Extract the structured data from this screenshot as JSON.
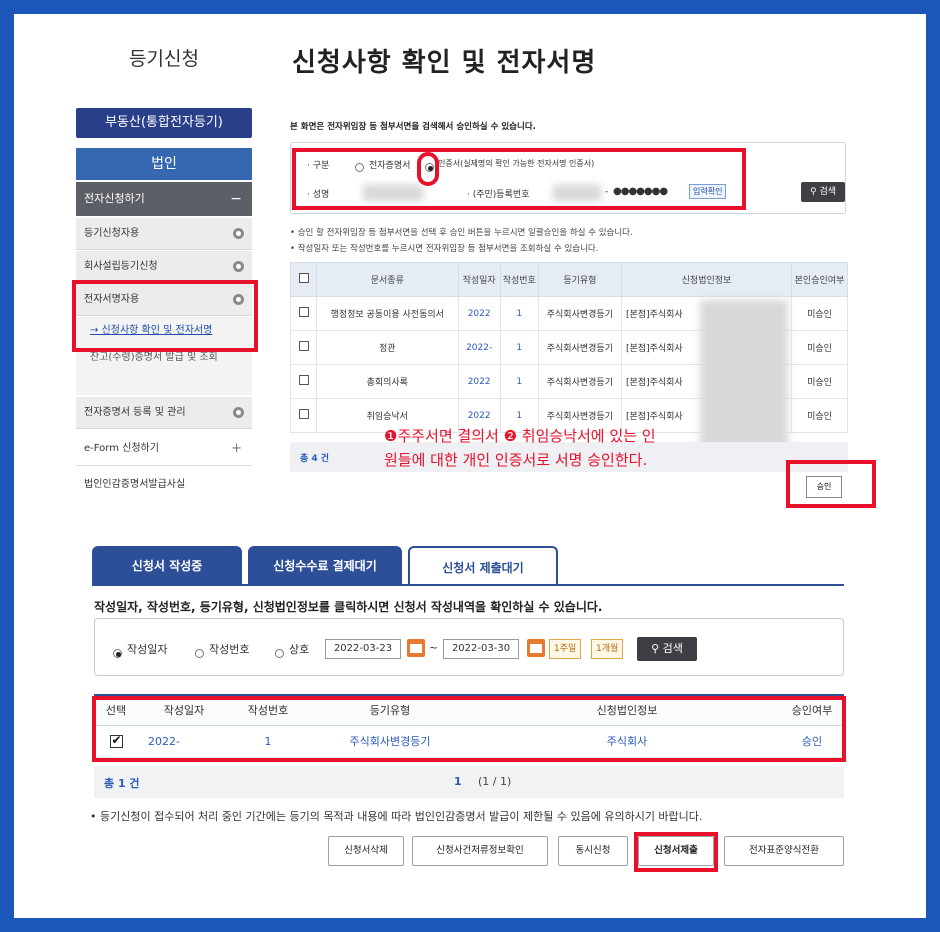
{
  "sidebar": {
    "title": "등기신청",
    "top_button": "부동산(통합전자등기)",
    "corp_button": "법인",
    "section_title": "전자신청하기",
    "section_toggle": "−",
    "items": [
      {
        "label": "등기신청자용"
      },
      {
        "label": "회사설립등기신청"
      },
      {
        "label": "전자서명자용"
      }
    ],
    "sub_link": "→ 신청사항 확인 및 전자서명",
    "sub_text": "잔고(수령)증명서 발급 및 조회",
    "item_cert": "전자증명서 등록 및 관리",
    "eform": "e-Form 신청하기",
    "eform_toggle": "+",
    "last": "법인인감증명서발급사실"
  },
  "page": {
    "title": "신청사항 확인 및 전자서명",
    "intro": "본 화면은 전자위임장 등 첨부서면을 검색해서 승인하실 수 있습니다."
  },
  "form": {
    "type_label": "· 구분",
    "opt1": "전자증명서",
    "opt2": "인증서(실제명의 확인 가능한 전자서명 인증서)",
    "name_label": "· 성명",
    "id_label": "· (주민)등록번호",
    "masked": "●●●●●●●",
    "input_confirm": "입력확인",
    "search": "검색"
  },
  "notes": {
    "n1": "• 승인 할 전자위임장 등 첨부서면을 선택 후 승인 버튼을 누르시면 일괄승인을 하실 수 있습니다.",
    "n2": "• 작성일자 또는 작성번호를 누르시면 전자위임장 등 첨부서면을 조회하실 수 있습니다."
  },
  "table1": {
    "headers": [
      "문서종류",
      "작성일자",
      "작성번호",
      "등기유형",
      "신청법인정보",
      "본인승인여부"
    ],
    "rows": [
      {
        "doc": "행정정보 공동이용 사전동의서",
        "date": "2022",
        "no": "1",
        "type": "주식회사변경등기",
        "corp": "[본점]주식회사",
        "status": "미승인"
      },
      {
        "doc": "정관",
        "date": "2022-",
        "no": "1",
        "type": "주식회사변경등기",
        "corp": "[본점]주식회사",
        "status": "미승인"
      },
      {
        "doc": "총회의사록",
        "date": "2022",
        "no": "1",
        "type": "주식회사변경등기",
        "corp": "[본점]주식회사",
        "status": "미승인"
      },
      {
        "doc": "취임승낙서",
        "date": "2022",
        "no": "1",
        "type": "주식회사변경등기",
        "corp": "[본점]주식회사",
        "status": "미승인"
      }
    ],
    "total": "총 4 건",
    "approve": "승인"
  },
  "annotation": {
    "line1": "❶주주서면 결의서 ❷ 취임승낙서에 있는 인",
    "line2": "원들에 대한 개인 인증서로 서명 승인한다."
  },
  "tabs": [
    {
      "label": "신청서 작성중"
    },
    {
      "label": "신청수수료 결제대기"
    },
    {
      "label": "신청서 제출대기"
    }
  ],
  "hint": "작성일자, 작성번호, 등기유형, 신청법인정보를 클릭하시면 신청서 작성내역을 확인하실 수 있습니다.",
  "search2": {
    "r1": "작성일자",
    "r2": "작성번호",
    "r3": "상호",
    "from": "2022-03-23",
    "tilde": "~",
    "to": "2022-03-30",
    "week": "1주일",
    "month": "1개월",
    "btn": "검색"
  },
  "table2": {
    "headers": [
      "선택",
      "작성일자",
      "작성번호",
      "등기유형",
      "신청법인정보",
      "승인여부"
    ],
    "row": {
      "date": "2022-",
      "no": "1",
      "type": "주식회사변경등기",
      "corp": "주식회사",
      "status": "승인"
    },
    "total": "총 1 건",
    "page": "1",
    "page_of": "(1 / 1)"
  },
  "notice": "• 등기신청이 접수되어 처리 중인 기간에는 등기의 목적과 내용에 따라 법인인감증명서 발급이 제한될 수 있음에 유의하시기 바랍니다.",
  "buttons": [
    "신청서삭제",
    "신청사건처류정보확인",
    "동시신청",
    "신청서제출",
    "전자표준양식전환"
  ]
}
